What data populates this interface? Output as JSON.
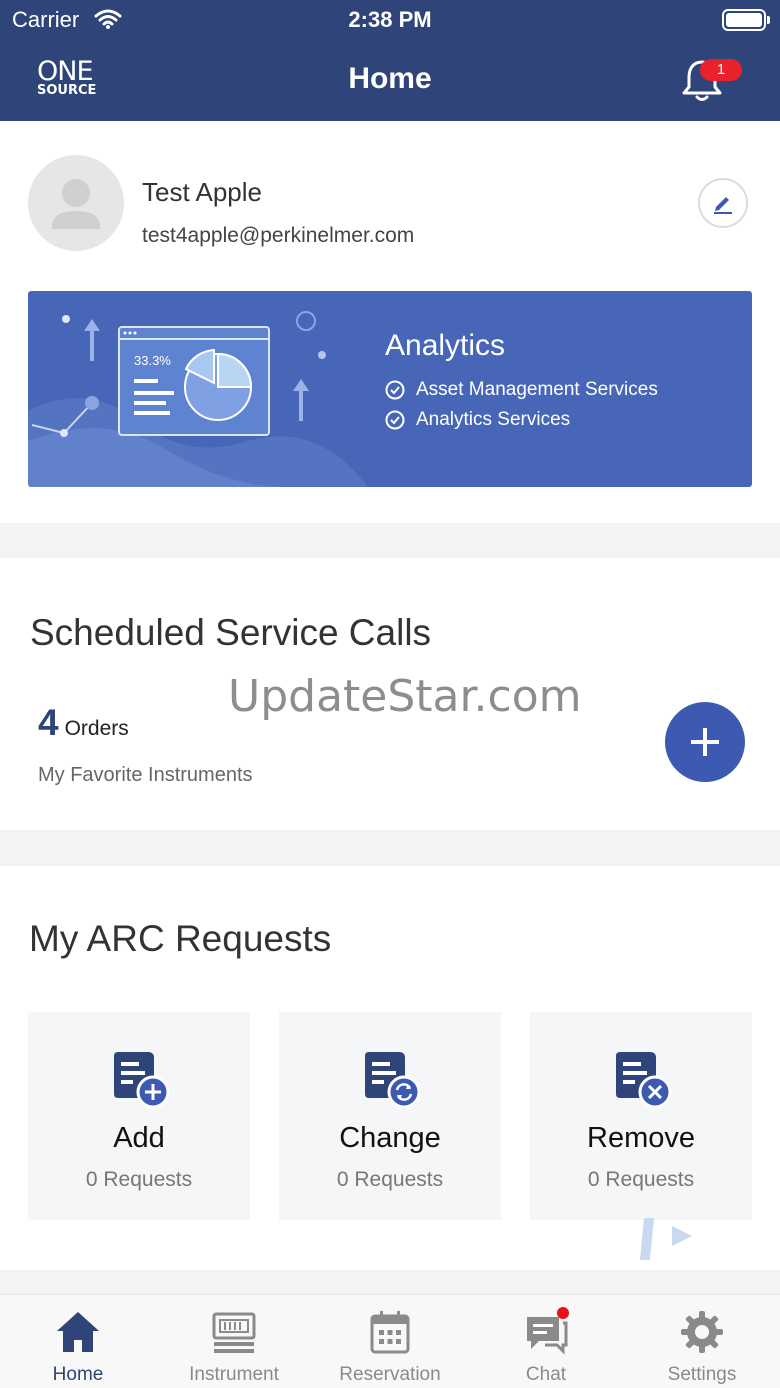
{
  "status_bar": {
    "carrier": "Carrier",
    "time": "2:38 PM"
  },
  "header": {
    "logo_line1": "ONE",
    "logo_line2": "SOURCE",
    "title": "Home",
    "notification_count": "1"
  },
  "profile": {
    "name": "Test Apple",
    "email": "test4apple@perkinelmer.com"
  },
  "banner": {
    "title": "Analytics",
    "chart_text": "33.3%",
    "items": [
      "Asset Management Services",
      "Analytics Services"
    ]
  },
  "scheduled": {
    "title": "Scheduled Service Calls",
    "orders_count": "4",
    "orders_label": "Orders",
    "favorites_label": "My Favorite Instruments",
    "watermark": "UpdateStar.com"
  },
  "arc": {
    "title": "My ARC Requests",
    "cards": [
      {
        "label": "Add",
        "count": "0 Requests",
        "icon": "document-add-icon"
      },
      {
        "label": "Change",
        "count": "0 Requests",
        "icon": "document-refresh-icon"
      },
      {
        "label": "Remove",
        "count": "0 Requests",
        "icon": "document-remove-icon"
      }
    ]
  },
  "tabs": [
    {
      "label": "Home",
      "icon": "home-icon",
      "active": true
    },
    {
      "label": "Instrument",
      "icon": "instrument-icon"
    },
    {
      "label": "Reservation",
      "icon": "calendar-icon"
    },
    {
      "label": "Chat",
      "icon": "chat-icon"
    },
    {
      "label": "Settings",
      "icon": "gear-icon"
    }
  ],
  "colors": {
    "primary": "#2f4478",
    "accent": "#3d5ab3",
    "banner": "#4766b8",
    "badge": "#e8212b"
  }
}
